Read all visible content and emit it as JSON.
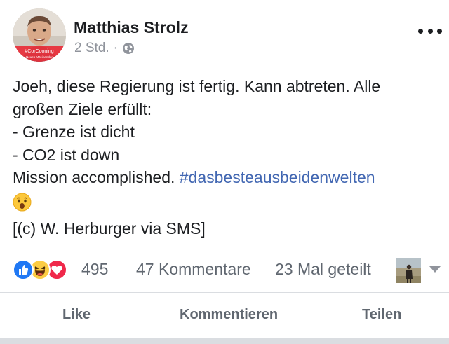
{
  "post": {
    "author": "Matthias Strolz",
    "avatar_banner": "#CorCooning",
    "avatar_banner_sub": "Neues Miteinander",
    "time": "2 Std.",
    "separator": "·",
    "privacy_icon": "globe-icon",
    "body_lines": [
      "Joeh, diese Regierung ist fertig. Kann abtreten. Alle",
      "großen Ziele erfüllt:",
      "- Grenze ist dicht",
      "- CO2 ist down",
      "Mission accomplished."
    ],
    "hashtag": "#dasbesteausbeidenwelten",
    "emoji": "wow-emoji",
    "credit": "[(c) W. Herburger via SMS]"
  },
  "reactions": {
    "icons": [
      "like-icon",
      "haha-icon",
      "love-icon"
    ],
    "count": "495",
    "comments": "47 Kommentare",
    "shares": "23 Mal geteilt"
  },
  "actions": {
    "like": "Like",
    "comment": "Kommentieren",
    "share": "Teilen"
  },
  "colors": {
    "hashtag": "#4267b2",
    "muted": "#606770",
    "like_blue": "#2078f4",
    "haha_yellow": "#fccc43",
    "love_red": "#f0284a",
    "banner_red": "#e8323c"
  }
}
